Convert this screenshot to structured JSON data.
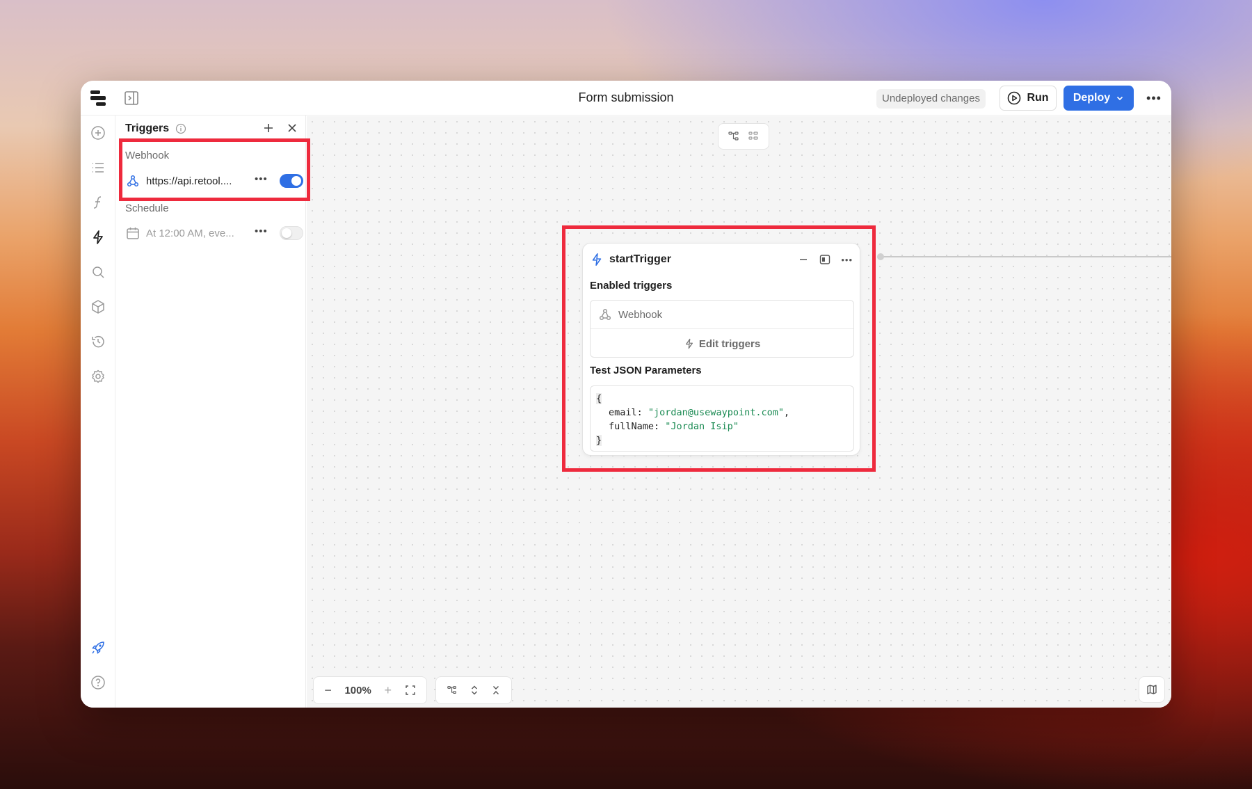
{
  "header": {
    "title": "Form submission",
    "undeployed_label": "Undeployed changes",
    "run_label": "Run",
    "deploy_label": "Deploy",
    "more_label": "•••"
  },
  "rail": {
    "items": [
      "add-icon",
      "list-icon",
      "function-icon",
      "lightning-icon",
      "search-icon",
      "cube-icon",
      "history-icon",
      "settings-icon",
      "rocket-icon",
      "help-icon"
    ]
  },
  "triggers_panel": {
    "title": "Triggers",
    "webhook_section": "Webhook",
    "webhook_url": "https://api.retool....",
    "webhook_enabled": true,
    "schedule_section": "Schedule",
    "schedule_text": "At 12:00 AM, eve...",
    "schedule_enabled": false,
    "dots": "•••"
  },
  "node": {
    "title": "startTrigger",
    "enabled_heading": "Enabled triggers",
    "webhook_label": "Webhook",
    "edit_triggers_label": "Edit triggers",
    "json_heading": "Test JSON Parameters",
    "json": {
      "open": "{",
      "email_key": "email: ",
      "email_value": "\"jordan@usewaypoint.com\"",
      "comma": ",",
      "name_key": "fullName: ",
      "name_value": "\"Jordan Isip\"",
      "close": "}"
    }
  },
  "zoom": {
    "minus": "−",
    "value": "100%",
    "plus": "+"
  },
  "colors": {
    "accent": "#2f6fe4",
    "highlight": "#ee2a3d",
    "json_string": "#1a8a52"
  }
}
